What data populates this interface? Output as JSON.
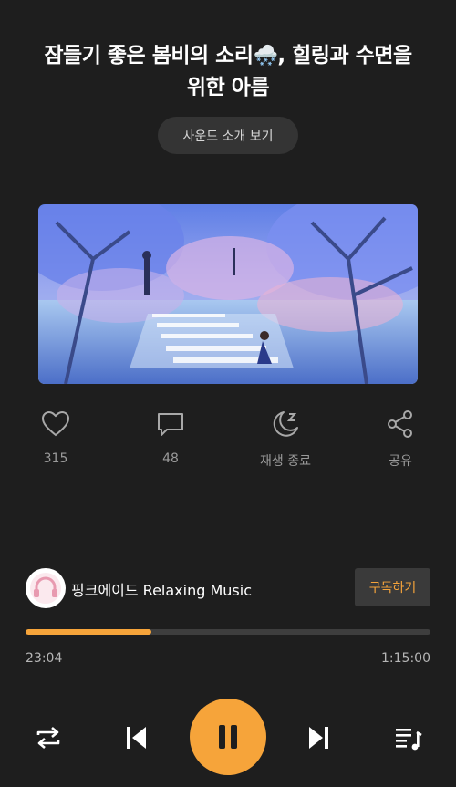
{
  "header": {
    "title_part1": "잠들기 좋은 봄비의 소리",
    "title_emoji": "🌨️",
    "title_part2": ", 힐링과 수면을",
    "title_line2": "위한 아름",
    "intro_button": "사운드 소개 보기"
  },
  "actions": [
    {
      "icon": "heart-icon",
      "label": "315"
    },
    {
      "icon": "comment-icon",
      "label": "48"
    },
    {
      "icon": "sleep-timer-icon",
      "label": "재생 종료"
    },
    {
      "icon": "share-icon",
      "label": "공유"
    }
  ],
  "channel": {
    "name": "핑크에이드 Relaxing Music",
    "subscribe_label": "구독하기"
  },
  "player": {
    "current_time": "23:04",
    "total_time": "1:15:00",
    "progress": 0.31
  },
  "colors": {
    "accent": "#f6a43a",
    "background": "#1e1e1e"
  }
}
